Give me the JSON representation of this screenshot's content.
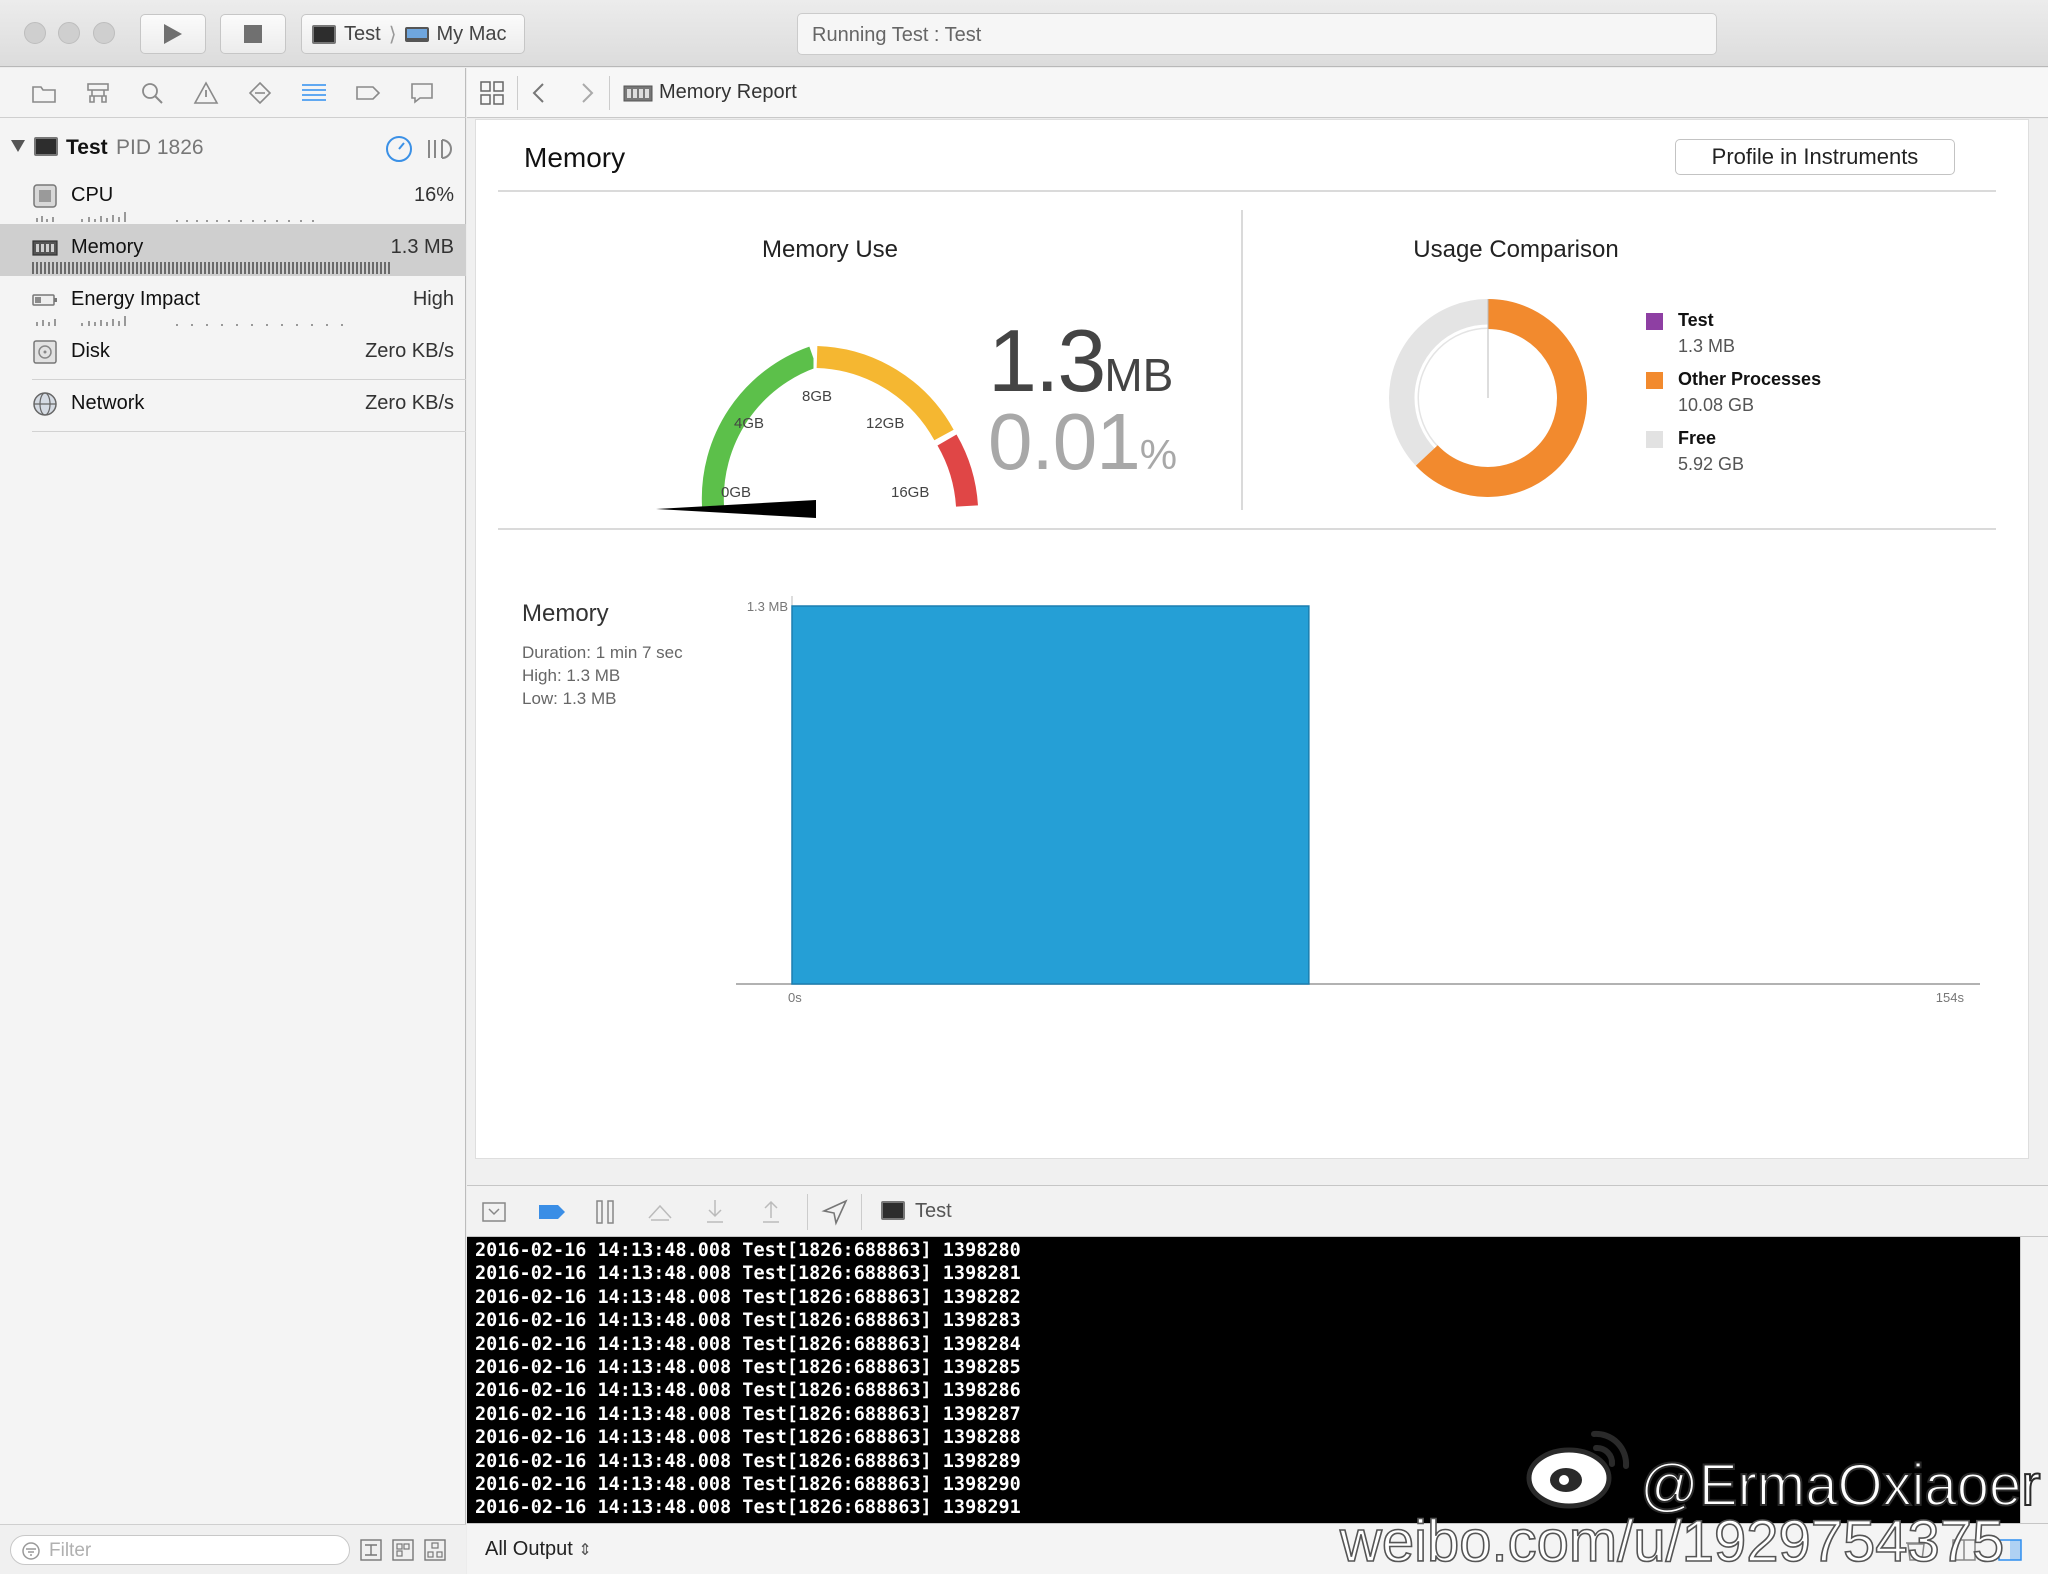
{
  "window": {
    "scheme_target": "Test",
    "scheme_device": "My Mac",
    "activity_status": "Running Test : Test"
  },
  "navigator": {
    "process_name": "Test",
    "process_pid": "PID 1826",
    "gauges": [
      {
        "label": "CPU",
        "value": "16%",
        "icon": "cpu-icon"
      },
      {
        "label": "Memory",
        "value": "1.3 MB",
        "icon": "memory-icon",
        "selected": true
      },
      {
        "label": "Energy Impact",
        "value": "High",
        "icon": "battery-icon"
      },
      {
        "label": "Disk",
        "value": "Zero KB/s",
        "icon": "disk-icon"
      },
      {
        "label": "Network",
        "value": "Zero KB/s",
        "icon": "network-icon"
      }
    ],
    "filter_placeholder": "Filter"
  },
  "jumpbar": {
    "title": "Memory Report"
  },
  "report": {
    "heading": "Memory",
    "profile_button": "Profile in Instruments",
    "memory_use": {
      "title": "Memory Use",
      "value": "1.3",
      "value_unit": "MB",
      "percent": "0.01",
      "percent_unit": "%",
      "gauge_ticks": [
        "0GB",
        "4GB",
        "8GB",
        "12GB",
        "16GB"
      ],
      "gauge_max_gb": 16,
      "gauge_segment_colors": [
        "#5cc04a",
        "#f5b731",
        "#e04646"
      ]
    },
    "usage_comparison": {
      "title": "Usage Comparison",
      "items": [
        {
          "name": "Test",
          "value": "1.3 MB",
          "color": "#8e3fa3"
        },
        {
          "name": "Other Processes",
          "value": "10.08 GB",
          "color": "#f28a2e"
        },
        {
          "name": "Free",
          "value": "5.92 GB",
          "color": "#e2e2e2"
        }
      ]
    },
    "timeline": {
      "title": "Memory",
      "duration": "Duration: 1 min 7 sec",
      "high": "High: 1.3 MB",
      "low": "Low: 1.3 MB"
    }
  },
  "chart_data": {
    "type": "area",
    "title": "Memory",
    "x": [
      0,
      67
    ],
    "values": [
      1.3,
      1.3
    ],
    "xlim": [
      0,
      154
    ],
    "ylim": [
      0,
      1.3
    ],
    "x_tick_labels": [
      "0s",
      "154s"
    ],
    "y_tick_labels": [
      "1.3 MB"
    ],
    "color": "#259fd6"
  },
  "debug": {
    "process_label": "Test",
    "output_filter": "All Output",
    "log_prefix": "2016-02-16 14:13:48.008 Test[1826:688863]",
    "log_lines": [
      "2016-02-16 14:13:48.008 Test[1826:688863] 1398280",
      "2016-02-16 14:13:48.008 Test[1826:688863] 1398281",
      "2016-02-16 14:13:48.008 Test[1826:688863] 1398282",
      "2016-02-16 14:13:48.008 Test[1826:688863] 1398283",
      "2016-02-16 14:13:48.008 Test[1826:688863] 1398284",
      "2016-02-16 14:13:48.008 Test[1826:688863] 1398285",
      "2016-02-16 14:13:48.008 Test[1826:688863] 1398286",
      "2016-02-16 14:13:48.008 Test[1826:688863] 1398287",
      "2016-02-16 14:13:48.008 Test[1826:688863] 1398288",
      "2016-02-16 14:13:48.008 Test[1826:688863] 1398289",
      "2016-02-16 14:13:48.008 Test[1826:688863] 1398290",
      "2016-02-16 14:13:48.008 Test[1826:688863] 1398291"
    ]
  },
  "watermark": {
    "handle": "@ErmaOxiaoer",
    "url": "weibo.com/u/1929754375"
  }
}
